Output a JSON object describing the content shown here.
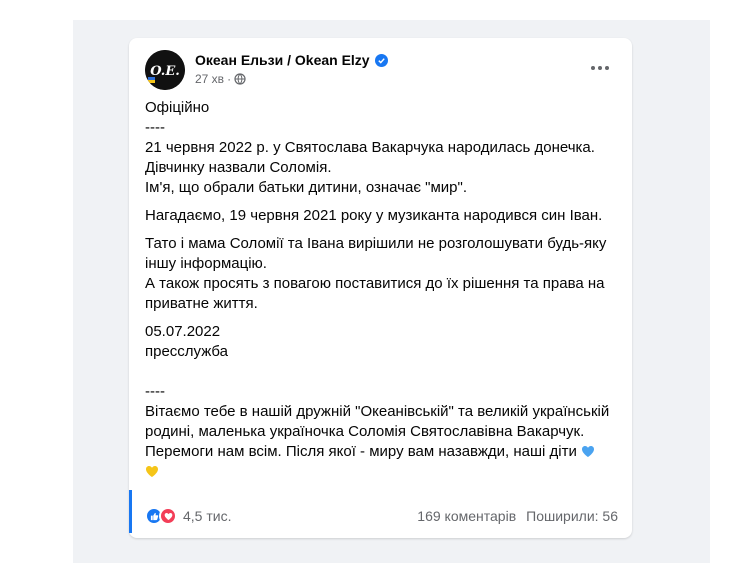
{
  "post": {
    "page_name": "Океан Ельзи / Okean Elzy",
    "avatar_text": "O.E.",
    "time": "27 хв",
    "separator": "·",
    "paragraphs": [
      "Офіційно\n----\n21 червня 2022 р. у Святослава Вакарчука народилась донечка.\nДівчинку назвали Соломія.\nІм'я, що обрали батьки дитини, означає \"мир\".",
      "Нагадаємо, 19 червня 2021 року у музиканта народився син Іван.",
      "Тато і мама Соломії та Івана вирішили не розголошувати будь-яку іншу інформацію.\nА також просять з повагою поставитися до їх рішення та права на приватне життя.",
      "05.07.2022\nпресслужба\n\n----\nВітаємо тебе в нашій дружній \"Океанівській\"  та великій українській родині, маленька україночка Соломія Святославівна Вакарчук.\nПеремоги нам всім. Після якої - миру вам назавжди, наші діти "
    ]
  },
  "footer": {
    "reactions_count": "4,5 тис.",
    "comments": "169 коментарів",
    "shares": "Поширили: 56"
  },
  "icons": {
    "verified": "verified-badge-icon",
    "audience": "globe-icon",
    "more": "more-options-icon",
    "like": "like-reaction-icon",
    "love": "love-reaction-icon",
    "hearts": [
      "blue-heart-icon",
      "yellow-heart-icon"
    ]
  },
  "colors": {
    "accent": "#1877f2",
    "love": "#f33e58",
    "blue_heart": "#4aa3f0",
    "yellow_heart": "#f5c518",
    "secondary_text": "#65676b"
  }
}
